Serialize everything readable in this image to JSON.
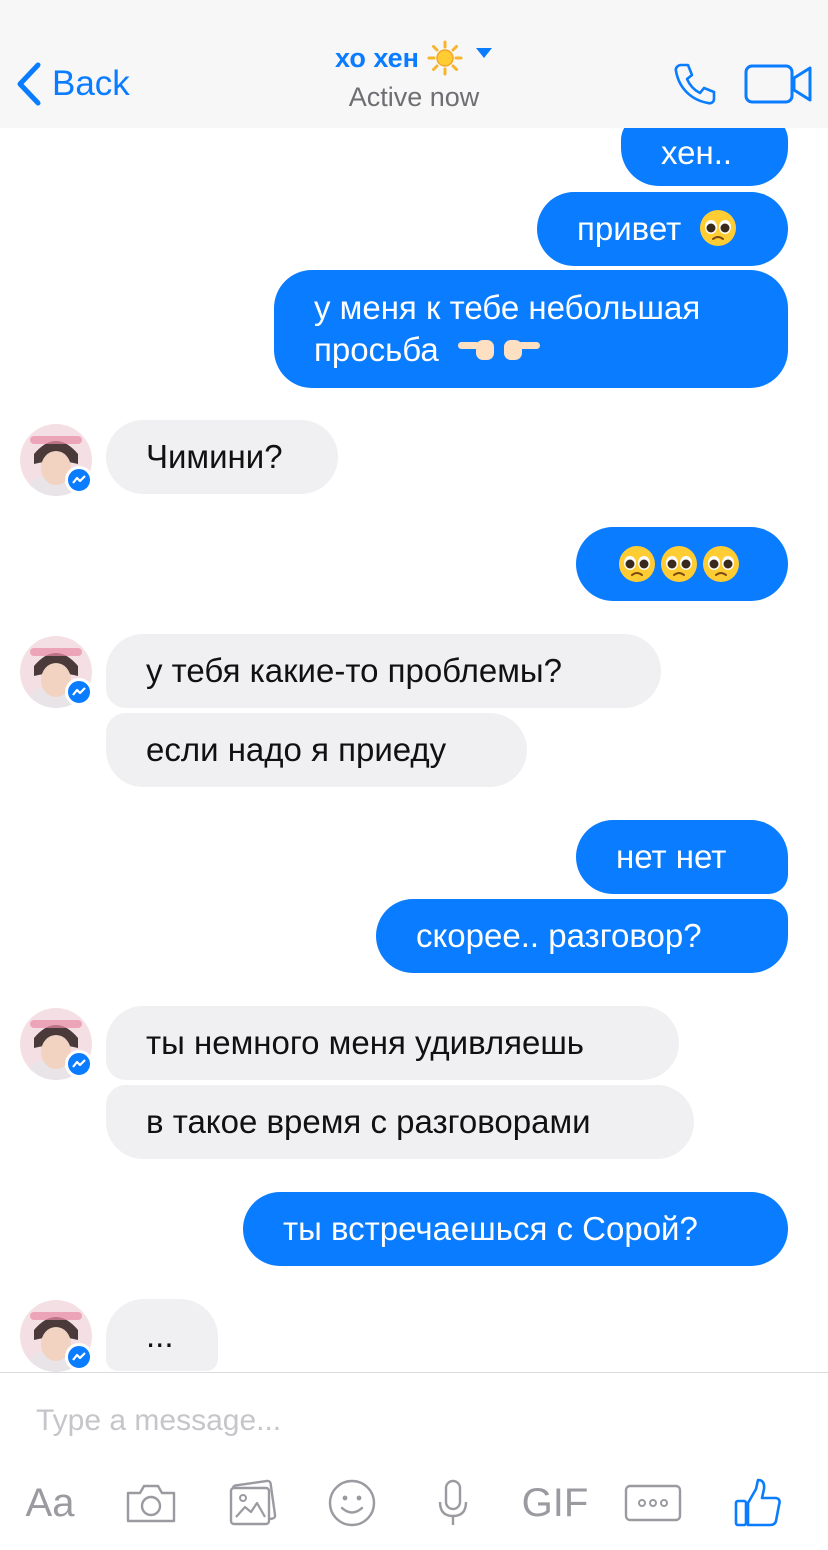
{
  "header": {
    "back_label": "Back",
    "contact_name": "хо хен",
    "status": "Active now"
  },
  "messages": [
    {
      "side": "out",
      "text": "хен.."
    },
    {
      "side": "out",
      "text": "привет",
      "emoji": "pleading-face"
    },
    {
      "side": "out",
      "lines": [
        "у меня к тебе небольшая",
        "просьба"
      ],
      "emoji": "pointing-fingers"
    },
    {
      "side": "in",
      "text": "Чимини?"
    },
    {
      "side": "out",
      "emoji": "pleading-face x3"
    },
    {
      "side": "in",
      "text": "у тебя какие-то проблемы?"
    },
    {
      "side": "in",
      "text": "если надо я приеду"
    },
    {
      "side": "out",
      "text": "нет нет"
    },
    {
      "side": "out",
      "text": "скорее.. разговор?"
    },
    {
      "side": "in",
      "text": "ты немного меня удивляешь"
    },
    {
      "side": "in",
      "text": "в такое время с разговорами"
    },
    {
      "side": "out",
      "text": "ты встречаешься с Сорой?"
    },
    {
      "side": "in",
      "text": "..."
    }
  ],
  "composer": {
    "placeholder": "Type a message...",
    "aa_label": "Aa",
    "gif_label": "GIF"
  },
  "colors": {
    "accent": "#0a7cff",
    "incoming_bubble": "#f0f0f2",
    "header_bg": "#f7f7f8"
  }
}
